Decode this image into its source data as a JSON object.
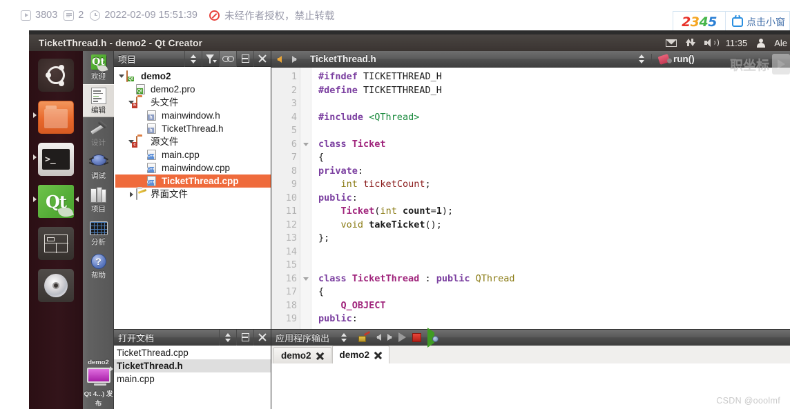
{
  "meta_bar": {
    "views": "3803",
    "comments": "2",
    "timestamp": "2022-02-09 15:51:39",
    "copyright_notice": "未经作者授权，禁止转载",
    "icons": {
      "views": "play-icon",
      "comments": "comment-icon",
      "time": "clock-icon",
      "ban": "no-reprint-icon"
    }
  },
  "ad_badge": {
    "digits": [
      "2",
      "3",
      "4",
      "5"
    ],
    "digit_colors": [
      "#e8322a",
      "#f5a623",
      "#45b649",
      "#2a7fd4"
    ],
    "text": "点击小窗",
    "tv_icon": "tv-icon"
  },
  "unity_panel": {
    "window_title": "TicketThread.h - demo2 - Qt Creator",
    "clock": "11:35",
    "user": "Ale",
    "icons": [
      "mail-icon",
      "network-icon",
      "volume-icon",
      "user-icon"
    ]
  },
  "launcher": {
    "items": [
      {
        "name": "ubuntu-dash",
        "label": "Ubuntu",
        "active": false,
        "running": false
      },
      {
        "name": "files",
        "label": "文件",
        "active": false,
        "running": true
      },
      {
        "name": "terminal",
        "label": "终端",
        "active": false,
        "running": true
      },
      {
        "name": "qt-creator",
        "label": "Qt Creator",
        "active": true,
        "running": true
      },
      {
        "name": "window-app",
        "label": "窗口",
        "active": false,
        "running": false
      },
      {
        "name": "disc",
        "label": "光盘",
        "active": false,
        "running": false
      }
    ]
  },
  "mode_selector": {
    "modes": [
      {
        "label": "欢迎",
        "icon": "qt-welcome-icon",
        "state": "normal"
      },
      {
        "label": "编辑",
        "icon": "edit-icon",
        "state": "selected"
      },
      {
        "label": "设计",
        "icon": "design-icon",
        "state": "disabled"
      },
      {
        "label": "调试",
        "icon": "debug-bug-icon",
        "state": "normal"
      },
      {
        "label": "项目",
        "icon": "projects-books-icon",
        "state": "normal"
      },
      {
        "label": "分析",
        "icon": "analyze-chart-icon",
        "state": "normal"
      },
      {
        "label": "帮助",
        "icon": "help-question-icon",
        "state": "normal"
      }
    ],
    "kit": {
      "project": "demo2",
      "config": "Qt 4...) 发布",
      "icon": "target-screen-icon"
    }
  },
  "projects_panel": {
    "title": "项目",
    "header_buttons": [
      "updown-icon",
      "filter-icon",
      "sync-link-icon",
      "split-icon",
      "close-icon"
    ],
    "tree": [
      {
        "depth": 0,
        "arrow": "down",
        "icon": "qt-project-folder-icon",
        "label": "demo2",
        "bold": true,
        "selected": false
      },
      {
        "depth": 1,
        "arrow": "none",
        "icon": "pro-file-icon",
        "label": "demo2.pro",
        "bold": false,
        "selected": false
      },
      {
        "depth": 1,
        "arrow": "down",
        "icon": "header-folder-icon",
        "label": "头文件",
        "bold": false,
        "selected": false
      },
      {
        "depth": 2,
        "arrow": "none",
        "icon": "header-file-icon",
        "label": "mainwindow.h",
        "bold": false,
        "selected": false
      },
      {
        "depth": 2,
        "arrow": "none",
        "icon": "header-file-icon",
        "label": "TicketThread.h",
        "bold": false,
        "selected": false
      },
      {
        "depth": 1,
        "arrow": "down",
        "icon": "source-folder-icon",
        "label": "源文件",
        "bold": false,
        "selected": false
      },
      {
        "depth": 2,
        "arrow": "none",
        "icon": "cpp-file-icon",
        "label": "main.cpp",
        "bold": false,
        "selected": false
      },
      {
        "depth": 2,
        "arrow": "none",
        "icon": "cpp-file-icon",
        "label": "mainwindow.cpp",
        "bold": false,
        "selected": false
      },
      {
        "depth": 2,
        "arrow": "none",
        "icon": "cpp-file-icon",
        "label": "TicketThread.cpp",
        "bold": false,
        "selected": true
      },
      {
        "depth": 1,
        "arrow": "right",
        "icon": "ui-folder-icon",
        "label": "界面文件",
        "bold": false,
        "selected": false
      }
    ],
    "selection_color": "#ef6b3c"
  },
  "open_documents_panel": {
    "title": "打开文档",
    "header_buttons": [
      "updown-icon",
      "split-icon",
      "close-icon"
    ],
    "documents": [
      {
        "label": "TicketThread.cpp",
        "selected": false
      },
      {
        "label": "TicketThread.h",
        "selected": true
      },
      {
        "label": "main.cpp",
        "selected": false
      }
    ]
  },
  "editor": {
    "file_name": "TicketThread.h",
    "symbol": "run()",
    "nav_back_icon": "arrow-left-icon",
    "nav_forward_icon": "arrow-right-icon",
    "lines": [
      {
        "n": "1",
        "fold": false,
        "tokens": [
          {
            "t": "#ifndef",
            "c": "k-pre"
          },
          {
            "t": " TICKETTHREAD_H",
            "c": "k-mac2"
          }
        ]
      },
      {
        "n": "2",
        "fold": false,
        "tokens": [
          {
            "t": "#define",
            "c": "k-pre"
          },
          {
            "t": " TICKETTHREAD_H",
            "c": "k-mac2"
          }
        ]
      },
      {
        "n": "3",
        "fold": false,
        "tokens": []
      },
      {
        "n": "4",
        "fold": false,
        "tokens": [
          {
            "t": "#include",
            "c": "k-pre"
          },
          {
            "t": " ",
            "c": "k-id"
          },
          {
            "t": "<QThread>",
            "c": "k-str"
          }
        ]
      },
      {
        "n": "5",
        "fold": false,
        "tokens": []
      },
      {
        "n": "6",
        "fold": true,
        "tokens": [
          {
            "t": "class",
            "c": "k-kw"
          },
          {
            "t": " ",
            "c": "k-id"
          },
          {
            "t": "Ticket",
            "c": "k-cls"
          }
        ]
      },
      {
        "n": "7",
        "fold": false,
        "tokens": [
          {
            "t": "{",
            "c": "k-id"
          }
        ]
      },
      {
        "n": "8",
        "fold": false,
        "tokens": [
          {
            "t": "private",
            "c": "k-kw"
          },
          {
            "t": ":",
            "c": "k-id"
          }
        ]
      },
      {
        "n": "9",
        "fold": false,
        "tokens": [
          {
            "t": "    ",
            "c": "k-id"
          },
          {
            "t": "int",
            "c": "k-typ"
          },
          {
            "t": " ",
            "c": "k-id"
          },
          {
            "t": "ticketCount",
            "c": "k-fld"
          },
          {
            "t": ";",
            "c": "k-id"
          }
        ]
      },
      {
        "n": "10",
        "fold": false,
        "tokens": [
          {
            "t": "public",
            "c": "k-kw"
          },
          {
            "t": ":",
            "c": "k-id"
          }
        ]
      },
      {
        "n": "11",
        "fold": false,
        "tokens": [
          {
            "t": "    ",
            "c": "k-id"
          },
          {
            "t": "Ticket",
            "c": "k-cls"
          },
          {
            "t": "(",
            "c": "k-id"
          },
          {
            "t": "int",
            "c": "k-typ"
          },
          {
            "t": " ",
            "c": "k-id"
          },
          {
            "t": "count",
            "c": "k-num"
          },
          {
            "t": "=",
            "c": "k-id"
          },
          {
            "t": "1",
            "c": "k-num"
          },
          {
            "t": ");",
            "c": "k-id"
          }
        ]
      },
      {
        "n": "12",
        "fold": false,
        "tokens": [
          {
            "t": "    ",
            "c": "k-id"
          },
          {
            "t": "void",
            "c": "k-typ"
          },
          {
            "t": " ",
            "c": "k-id"
          },
          {
            "t": "takeTicket",
            "c": "k-num"
          },
          {
            "t": "();",
            "c": "k-id"
          }
        ]
      },
      {
        "n": "13",
        "fold": false,
        "tokens": [
          {
            "t": "};",
            "c": "k-id"
          }
        ]
      },
      {
        "n": "14",
        "fold": false,
        "tokens": []
      },
      {
        "n": "15",
        "fold": false,
        "tokens": []
      },
      {
        "n": "16",
        "fold": true,
        "tokens": [
          {
            "t": "class",
            "c": "k-kw"
          },
          {
            "t": " ",
            "c": "k-id"
          },
          {
            "t": "TicketThread",
            "c": "k-cls"
          },
          {
            "t": " : ",
            "c": "k-id"
          },
          {
            "t": "public",
            "c": "k-kw"
          },
          {
            "t": " ",
            "c": "k-id"
          },
          {
            "t": "QThread",
            "c": "k-typ"
          }
        ]
      },
      {
        "n": "17",
        "fold": false,
        "tokens": [
          {
            "t": "{",
            "c": "k-id"
          }
        ]
      },
      {
        "n": "18",
        "fold": false,
        "tokens": [
          {
            "t": "    ",
            "c": "k-id"
          },
          {
            "t": "Q_OBJECT",
            "c": "k-mac"
          }
        ]
      },
      {
        "n": "19",
        "fold": false,
        "tokens": [
          {
            "t": "public",
            "c": "k-kw"
          },
          {
            "t": ":",
            "c": "k-id"
          }
        ]
      }
    ]
  },
  "output_pane": {
    "title": "应用程序输出",
    "toolbar_icons": [
      "clear-broom-icon",
      "prev-arrow-icon",
      "next-arrow-icon",
      "play-icon",
      "stop-icon",
      "restart-icon"
    ],
    "tabs": [
      {
        "label": "demo2",
        "active": false
      },
      {
        "label": "demo2",
        "active": true
      }
    ]
  },
  "watermarks": {
    "top_right": "职坐标",
    "bottom_right": "CSDN @ooolmf"
  }
}
